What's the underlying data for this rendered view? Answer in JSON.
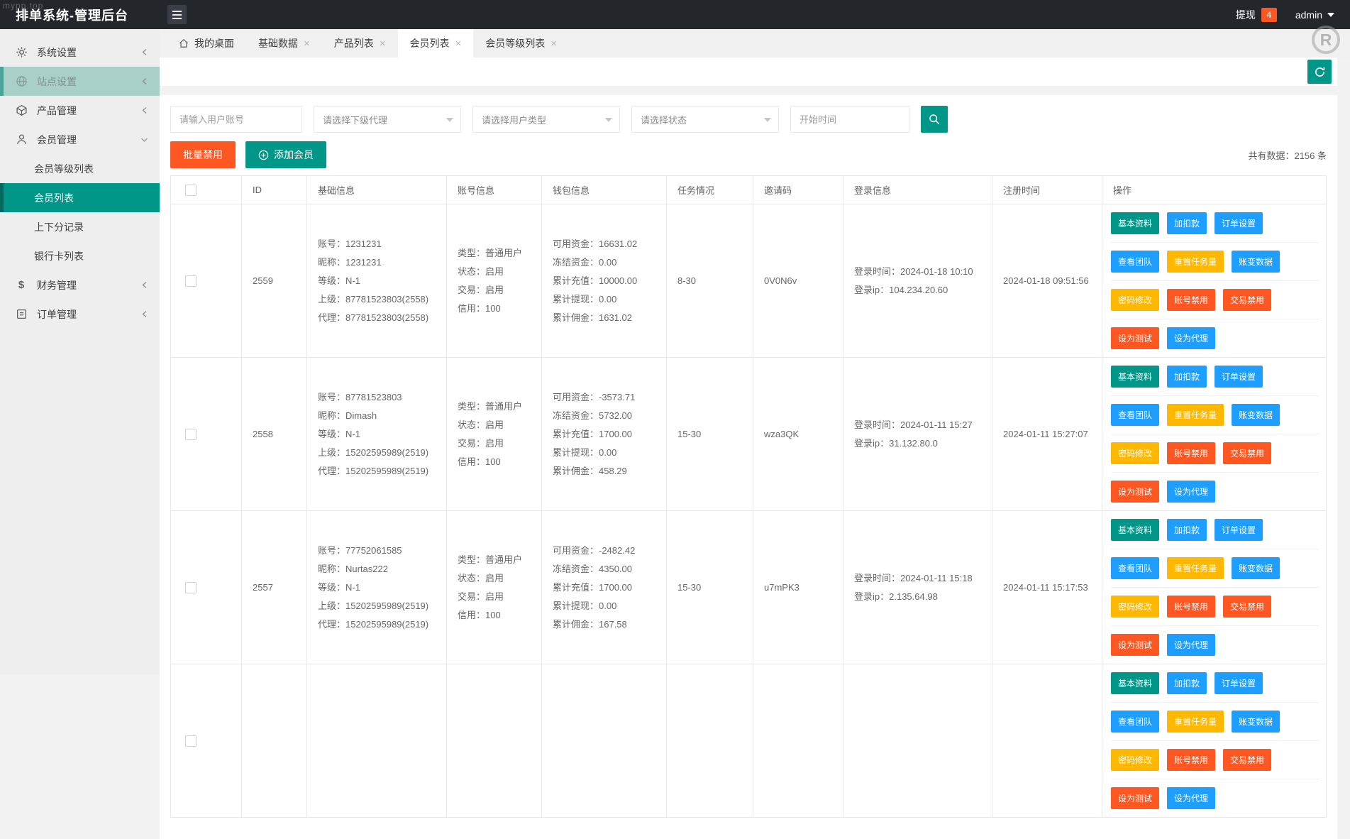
{
  "watermark": {
    "corner_text": "mypp.top",
    "logo_letter": "R"
  },
  "colors": {
    "green": "#009688",
    "blue": "#1E9FFF",
    "yellow": "#FFB800",
    "red": "#FF5722"
  },
  "icons": {
    "close_glyph": "×",
    "dollar_glyph": "$"
  },
  "header": {
    "title": "排单系统-管理后台",
    "withdraw_label": "提现",
    "withdraw_count": "4",
    "user": "admin"
  },
  "sidebar": {
    "items": [
      {
        "label": "系统设置"
      },
      {
        "label": "站点设置"
      },
      {
        "label": "产品管理"
      },
      {
        "label": "会员管理"
      },
      {
        "label": "财务管理"
      },
      {
        "label": "订单管理"
      }
    ],
    "member_children": [
      {
        "label": "会员等级列表",
        "active": false
      },
      {
        "label": "会员列表",
        "active": true
      },
      {
        "label": "上下分记录",
        "active": false
      },
      {
        "label": "银行卡列表",
        "active": false
      }
    ]
  },
  "tabs": [
    {
      "label": "我的桌面",
      "home": true,
      "closable": false,
      "active": false
    },
    {
      "label": "基础数据",
      "home": false,
      "closable": true,
      "active": false
    },
    {
      "label": "产品列表",
      "home": false,
      "closable": true,
      "active": false
    },
    {
      "label": "会员列表",
      "home": false,
      "closable": true,
      "active": true
    },
    {
      "label": "会员等级列表",
      "home": false,
      "closable": true,
      "active": false
    }
  ],
  "filters": {
    "account_placeholder": "请输入用户账号",
    "agent_select": "请选择下级代理",
    "type_select": "请选择用户类型",
    "status_select": "请选择状态",
    "time_placeholder": "开始时间"
  },
  "toolbar": {
    "batch_disable": "批量禁用",
    "add_member": "添加会员",
    "total_text": "共有数据：2156 条"
  },
  "table": {
    "headers": [
      "ID",
      "基础信息",
      "账号信息",
      "钱包信息",
      "任务情况",
      "邀请码",
      "登录信息",
      "注册时间",
      "操作"
    ]
  },
  "actions": [
    [
      {
        "name": "basic-info-button",
        "label": "基本资料",
        "color": "green"
      },
      {
        "name": "adjust-funds-button",
        "label": "加扣款",
        "color": "blue"
      },
      {
        "name": "order-settings-button",
        "label": "订单设置",
        "color": "blue"
      }
    ],
    [
      {
        "name": "view-team-button",
        "label": "查看团队",
        "color": "blue"
      },
      {
        "name": "reset-tasks-button",
        "label": "重置任务量",
        "color": "yellow"
      },
      {
        "name": "balance-log-button",
        "label": "账变数据",
        "color": "blue"
      }
    ],
    [
      {
        "name": "change-password-button",
        "label": "密码修改",
        "color": "yellow"
      },
      {
        "name": "disable-account-button",
        "label": "账号禁用",
        "color": "red"
      },
      {
        "name": "disable-trade-button",
        "label": "交易禁用",
        "color": "red"
      }
    ],
    [
      {
        "name": "set-test-button",
        "label": "设为测试",
        "color": "red"
      },
      {
        "name": "set-agent-button",
        "label": "设为代理",
        "color": "blue"
      }
    ]
  ],
  "members": [
    {
      "id": "2559",
      "basic": [
        [
          "账号",
          "1231231"
        ],
        [
          "昵称",
          "1231231"
        ],
        [
          "等级",
          "N-1"
        ],
        [
          "上级",
          "87781523803(2558)"
        ],
        [
          "代理",
          "87781523803(2558)"
        ]
      ],
      "account": [
        [
          "类型",
          "普通用户"
        ],
        [
          "状态",
          "启用"
        ],
        [
          "交易",
          "启用"
        ],
        [
          "信用",
          "100"
        ]
      ],
      "wallet": [
        [
          "可用资金",
          "16631.02"
        ],
        [
          "冻结资金",
          "0.00"
        ],
        [
          "累计充值",
          "10000.00"
        ],
        [
          "累计提现",
          "0.00"
        ],
        [
          "累计佣金",
          "1631.02"
        ]
      ],
      "task": "8-30",
      "invite": "0V0N6v",
      "login": [
        [
          "登录时间",
          "2024-01-18 10:10"
        ],
        [
          "登录ip",
          "104.234.20.60"
        ]
      ],
      "registered": "2024-01-18 09:51:56"
    },
    {
      "id": "2558",
      "basic": [
        [
          "账号",
          "87781523803"
        ],
        [
          "昵称",
          "Dimash"
        ],
        [
          "等级",
          "N-1"
        ],
        [
          "上级",
          "15202595989(2519)"
        ],
        [
          "代理",
          "15202595989(2519)"
        ]
      ],
      "account": [
        [
          "类型",
          "普通用户"
        ],
        [
          "状态",
          "启用"
        ],
        [
          "交易",
          "启用"
        ],
        [
          "信用",
          "100"
        ]
      ],
      "wallet": [
        [
          "可用资金",
          "-3573.71"
        ],
        [
          "冻结资金",
          "5732.00"
        ],
        [
          "累计充值",
          "1700.00"
        ],
        [
          "累计提现",
          "0.00"
        ],
        [
          "累计佣金",
          "458.29"
        ]
      ],
      "task": "15-30",
      "invite": "wza3QK",
      "login": [
        [
          "登录时间",
          "2024-01-11 15:27"
        ],
        [
          "登录ip",
          "31.132.80.0"
        ]
      ],
      "registered": "2024-01-11 15:27:07"
    },
    {
      "id": "2557",
      "basic": [
        [
          "账号",
          "77752061585"
        ],
        [
          "昵称",
          "Nurtas222"
        ],
        [
          "等级",
          "N-1"
        ],
        [
          "上级",
          "15202595989(2519)"
        ],
        [
          "代理",
          "15202595989(2519)"
        ]
      ],
      "account": [
        [
          "类型",
          "普通用户"
        ],
        [
          "状态",
          "启用"
        ],
        [
          "交易",
          "启用"
        ],
        [
          "信用",
          "100"
        ]
      ],
      "wallet": [
        [
          "可用资金",
          "-2482.42"
        ],
        [
          "冻结资金",
          "4350.00"
        ],
        [
          "累计充值",
          "1700.00"
        ],
        [
          "累计提现",
          "0.00"
        ],
        [
          "累计佣金",
          "167.58"
        ]
      ],
      "task": "15-30",
      "invite": "u7mPK3",
      "login": [
        [
          "登录时间",
          "2024-01-11 15:18"
        ],
        [
          "登录ip",
          "2.135.64.98"
        ]
      ],
      "registered": "2024-01-11 15:17:53"
    },
    {
      "id": "",
      "basic": [],
      "account": [],
      "wallet": [],
      "task": "",
      "invite": "",
      "login": [],
      "registered": ""
    }
  ]
}
